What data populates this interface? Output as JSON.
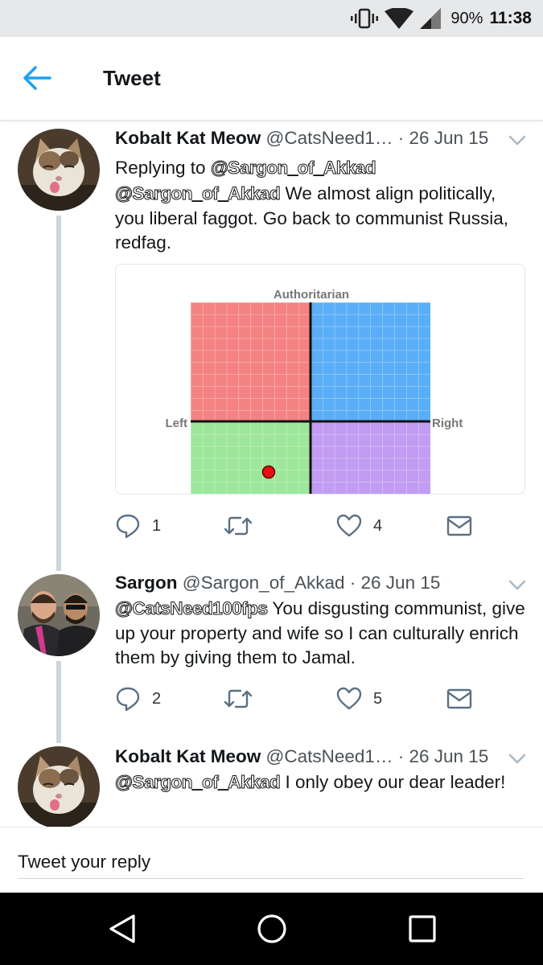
{
  "status_bar": {
    "battery_percent": "90%",
    "time": "11:38"
  },
  "app_bar": {
    "title": "Tweet"
  },
  "tweets": [
    {
      "name": "Kobalt Kat Meow",
      "handle": "@CatsNeed1…",
      "date": "· 26 Jun 15",
      "replying_label": "Replying to",
      "replying_to": "@Sargon_of_Akkad",
      "mention": "@Sargon_of_Akkad",
      "text": " We almost align politically, you liberal faggot. Go back to communist Russia, redfag.",
      "replies": "1",
      "likes": "4",
      "media": {
        "top_label": "Authoritarian",
        "left_label": "Left",
        "right_label": "Right",
        "colors": {
          "authoritarian_left": "#f48282",
          "authoritarian_right": "#5aaef8",
          "libertarian_left": "#9ee79a",
          "libertarian_right": "#c19cf2",
          "dot": "#e41010"
        }
      }
    },
    {
      "name": "Sargon",
      "handle": "@Sargon_of_Akkad",
      "date": "· 26 Jun 15",
      "mention": "@CatsNeed100fps",
      "text": " You disgusting communist, give up your property and wife so I can culturally enrich them by giving them to Jamal.",
      "replies": "2",
      "likes": "5"
    },
    {
      "name": "Kobalt Kat Meow",
      "handle": "@CatsNeed1…",
      "date": "· 26 Jun 15",
      "mention": "@Sargon_of_Akkad",
      "text": " I only obey our dear leader!"
    }
  ],
  "reply_bar": {
    "placeholder": "Tweet your reply"
  },
  "icons": {
    "back": "arrow-left-icon",
    "reply": "speech-bubble-icon",
    "retweet": "retweet-arrows-icon",
    "like": "heart-icon",
    "dm": "envelope-icon",
    "more": "chevron-down-icon",
    "nav_back": "triangle-back-icon",
    "nav_home": "circle-home-icon",
    "nav_recents": "square-recents-icon"
  },
  "accent_color": "#1da1f2"
}
